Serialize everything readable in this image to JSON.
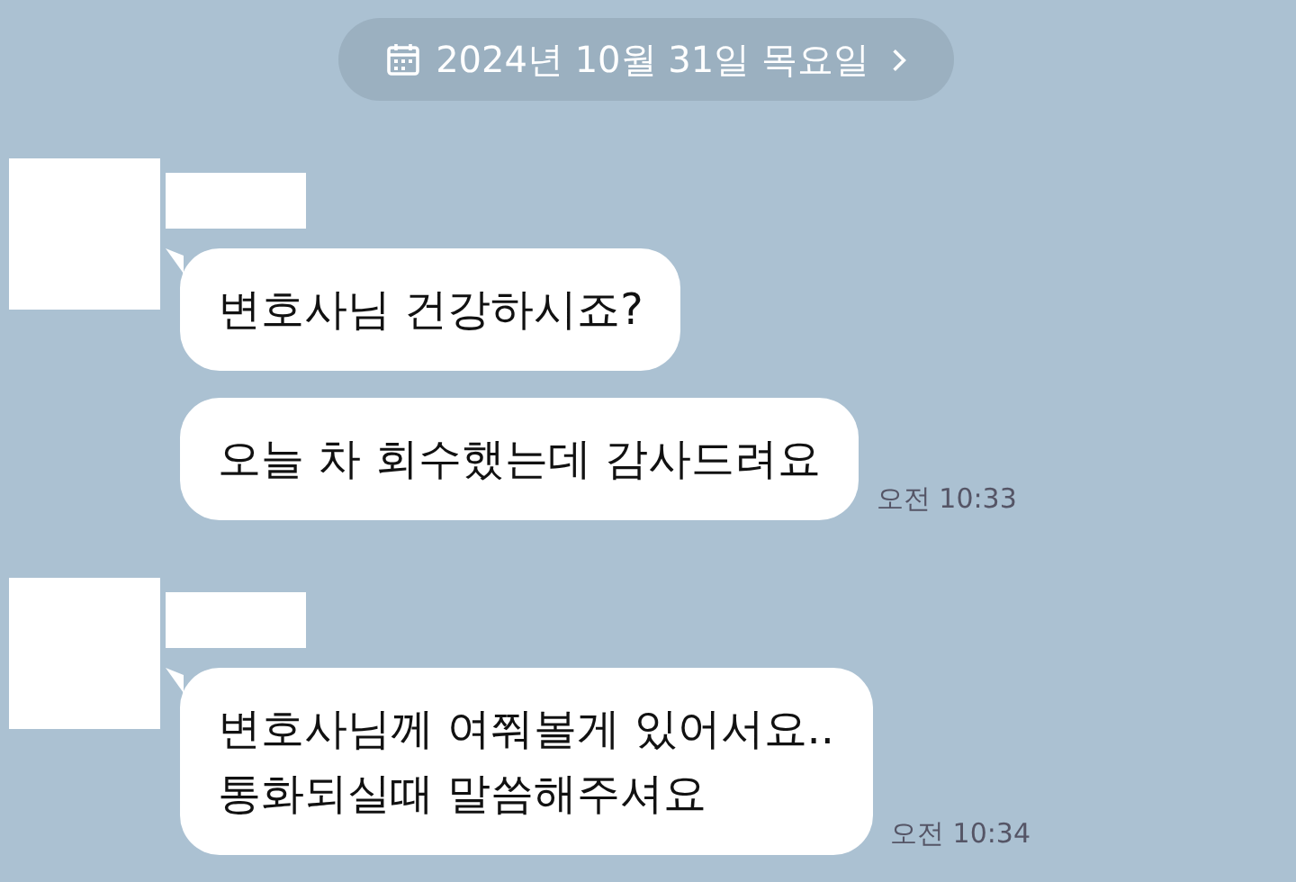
{
  "date_divider": {
    "label": "2024년 10월 31일 목요일"
  },
  "groups": [
    {
      "messages": [
        {
          "text": "변호사님 건강하시죠?",
          "tail": true
        },
        {
          "text": "오늘 차 회수했는데 감사드려요",
          "tail": false,
          "time": "오전 10:33"
        }
      ]
    },
    {
      "messages": [
        {
          "text": "변호사님께 여쭤볼게 있어서요..\n통화되실때 말씀해주셔요",
          "tail": true,
          "time": "오전 10:34"
        }
      ]
    }
  ]
}
